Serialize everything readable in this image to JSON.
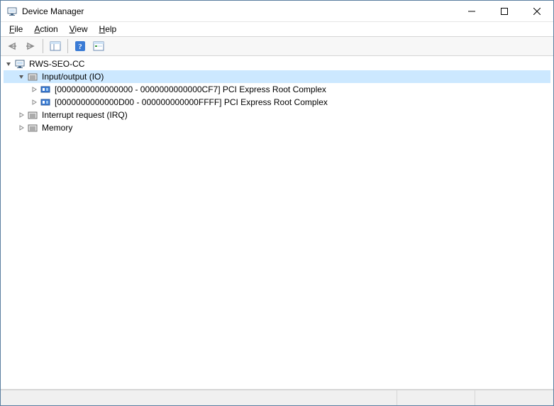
{
  "window": {
    "title": "Device Manager"
  },
  "menu": {
    "file": "File",
    "action": "Action",
    "view": "View",
    "help": "Help"
  },
  "tree": {
    "root": "RWS-SEO-CC",
    "io": {
      "label": "Input/output (IO)",
      "child1": "[0000000000000000 - 0000000000000CF7]  PCI Express Root Complex",
      "child2": "[0000000000000D00 - 000000000000FFFF]  PCI Express Root Complex"
    },
    "irq": "Interrupt request (IRQ)",
    "memory": "Memory"
  }
}
